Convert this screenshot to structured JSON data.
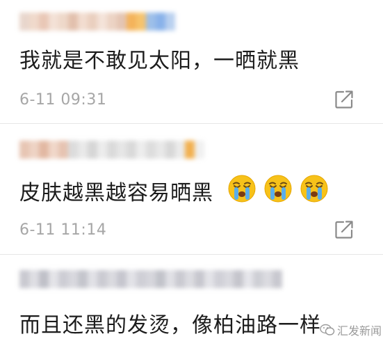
{
  "colors": {
    "text": "#1c1c1c",
    "timestamp": "#a6a6a6",
    "divider": "#e6e6e6",
    "emoji_face": "#f7c21a",
    "emoji_tears": "#5aaeea",
    "blur_palette": [
      "#e9c9b8",
      "#f1dccf",
      "#c8c8d0",
      "#e6e6ea",
      "#f5b560",
      "#8fb6ea",
      "#dedede"
    ]
  },
  "comments": [
    {
      "text": "我就是不敢见太阳，一晒就黑",
      "timestamp": "6-11 09:31",
      "emojis": []
    },
    {
      "text": "皮肤越黑越容易晒黑",
      "timestamp": "6-11 11:14",
      "emojis": [
        "crying-face-icon",
        "crying-face-icon",
        "crying-face-icon"
      ]
    },
    {
      "text": "而且还黑的发烫，像柏油路一样",
      "timestamp": "",
      "emojis": []
    }
  ],
  "watermark": {
    "text": "汇发新闻"
  }
}
